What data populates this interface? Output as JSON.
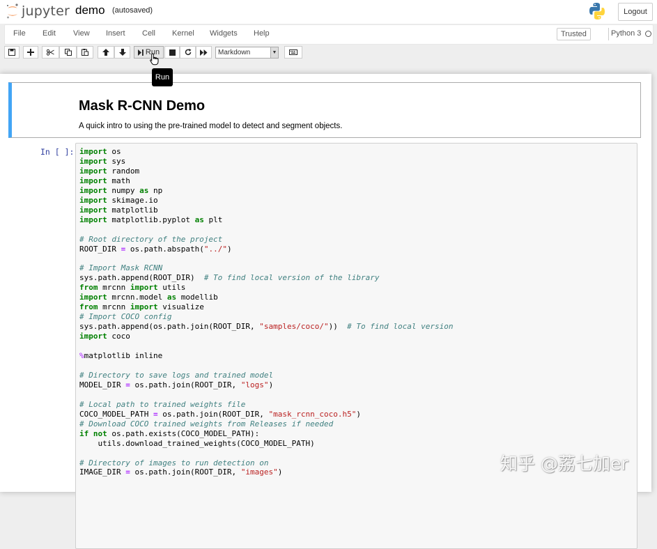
{
  "header": {
    "logo_text": "jupyter",
    "notebook_name": "demo",
    "save_status": "(autosaved)",
    "logout_label": "Logout"
  },
  "menubar": {
    "items": [
      "File",
      "Edit",
      "View",
      "Insert",
      "Cell",
      "Kernel",
      "Widgets",
      "Help"
    ],
    "trusted_label": "Trusted",
    "kernel_name": "Python 3"
  },
  "toolbar": {
    "run_label": "Run",
    "cell_type": "Markdown",
    "tooltip": "Run",
    "icons": [
      "save-icon",
      "plus-icon",
      "scissors-icon",
      "copy-icon",
      "paste-icon",
      "arrow-up-icon",
      "arrow-down-icon",
      "step-forward-icon",
      "stop-icon",
      "refresh-icon",
      "fast-forward-icon",
      "keyboard-icon"
    ]
  },
  "cells": {
    "markdown": {
      "title": "Mask R-CNN Demo",
      "body": "A quick intro to using the pre-trained model to detect and segment objects."
    },
    "code": {
      "prompt": "In [ ]:",
      "lines": [
        "import os",
        "import sys",
        "import random",
        "import math",
        "import numpy as np",
        "import skimage.io",
        "import matplotlib",
        "import matplotlib.pyplot as plt",
        "",
        "# Root directory of the project",
        "ROOT_DIR = os.path.abspath(\"../\")",
        "",
        "# Import Mask RCNN",
        "sys.path.append(ROOT_DIR)  # To find local version of the library",
        "from mrcnn import utils",
        "import mrcnn.model as modellib",
        "from mrcnn import visualize",
        "# Import COCO config",
        "sys.path.append(os.path.join(ROOT_DIR, \"samples/coco/\"))  # To find local version",
        "import coco",
        "",
        "%matplotlib inline",
        "",
        "# Directory to save logs and trained model",
        "MODEL_DIR = os.path.join(ROOT_DIR, \"logs\")",
        "",
        "# Local path to trained weights file",
        "COCO_MODEL_PATH = os.path.join(ROOT_DIR, \"mask_rcnn_coco.h5\")",
        "# Download COCO trained weights from Releases if needed",
        "if not os.path.exists(COCO_MODEL_PATH):",
        "    utils.download_trained_weights(COCO_MODEL_PATH)",
        "",
        "# Directory of images to run detection on",
        "IMAGE_DIR = os.path.join(ROOT_DIR, \"images\")"
      ]
    }
  },
  "watermark": "知乎 @荔七加er",
  "colors": {
    "selected_cell_border": "#42a5f5",
    "prompt": "#303f9f",
    "keyword": "#008000",
    "comment": "#408080",
    "string": "#ba2121",
    "operator": "#aa22ff"
  }
}
